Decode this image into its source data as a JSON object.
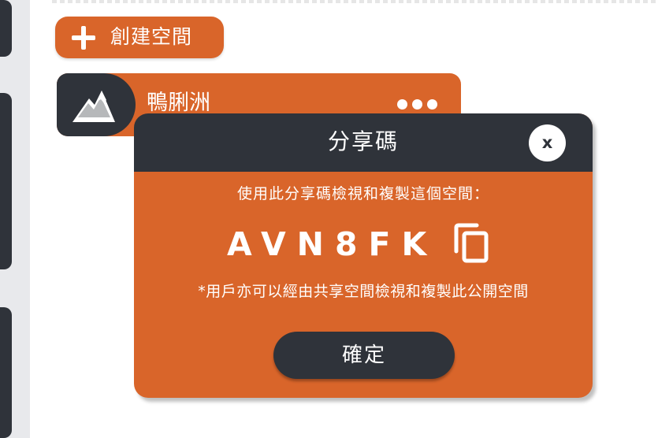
{
  "toolbar": {
    "create_label": "創建空間",
    "create_icon": "plus-icon"
  },
  "space_card": {
    "title": "鴨脷洲",
    "icon": "mountain-icon",
    "more_icon": "more-options-icon"
  },
  "modal": {
    "title": "分享碼",
    "close_label": "x",
    "instruction": "使用此分享碼檢視和複製這個空間：",
    "code": "AVN8FK",
    "copy_icon": "copy-icon",
    "note": "*用戶亦可以經由共享空間檢視和複製此公開空間",
    "confirm_label": "確定"
  },
  "colors": {
    "accent": "#d9652a",
    "dark": "#2f333a",
    "background": "#ffffff",
    "sidebar": "#e8e9ec"
  }
}
